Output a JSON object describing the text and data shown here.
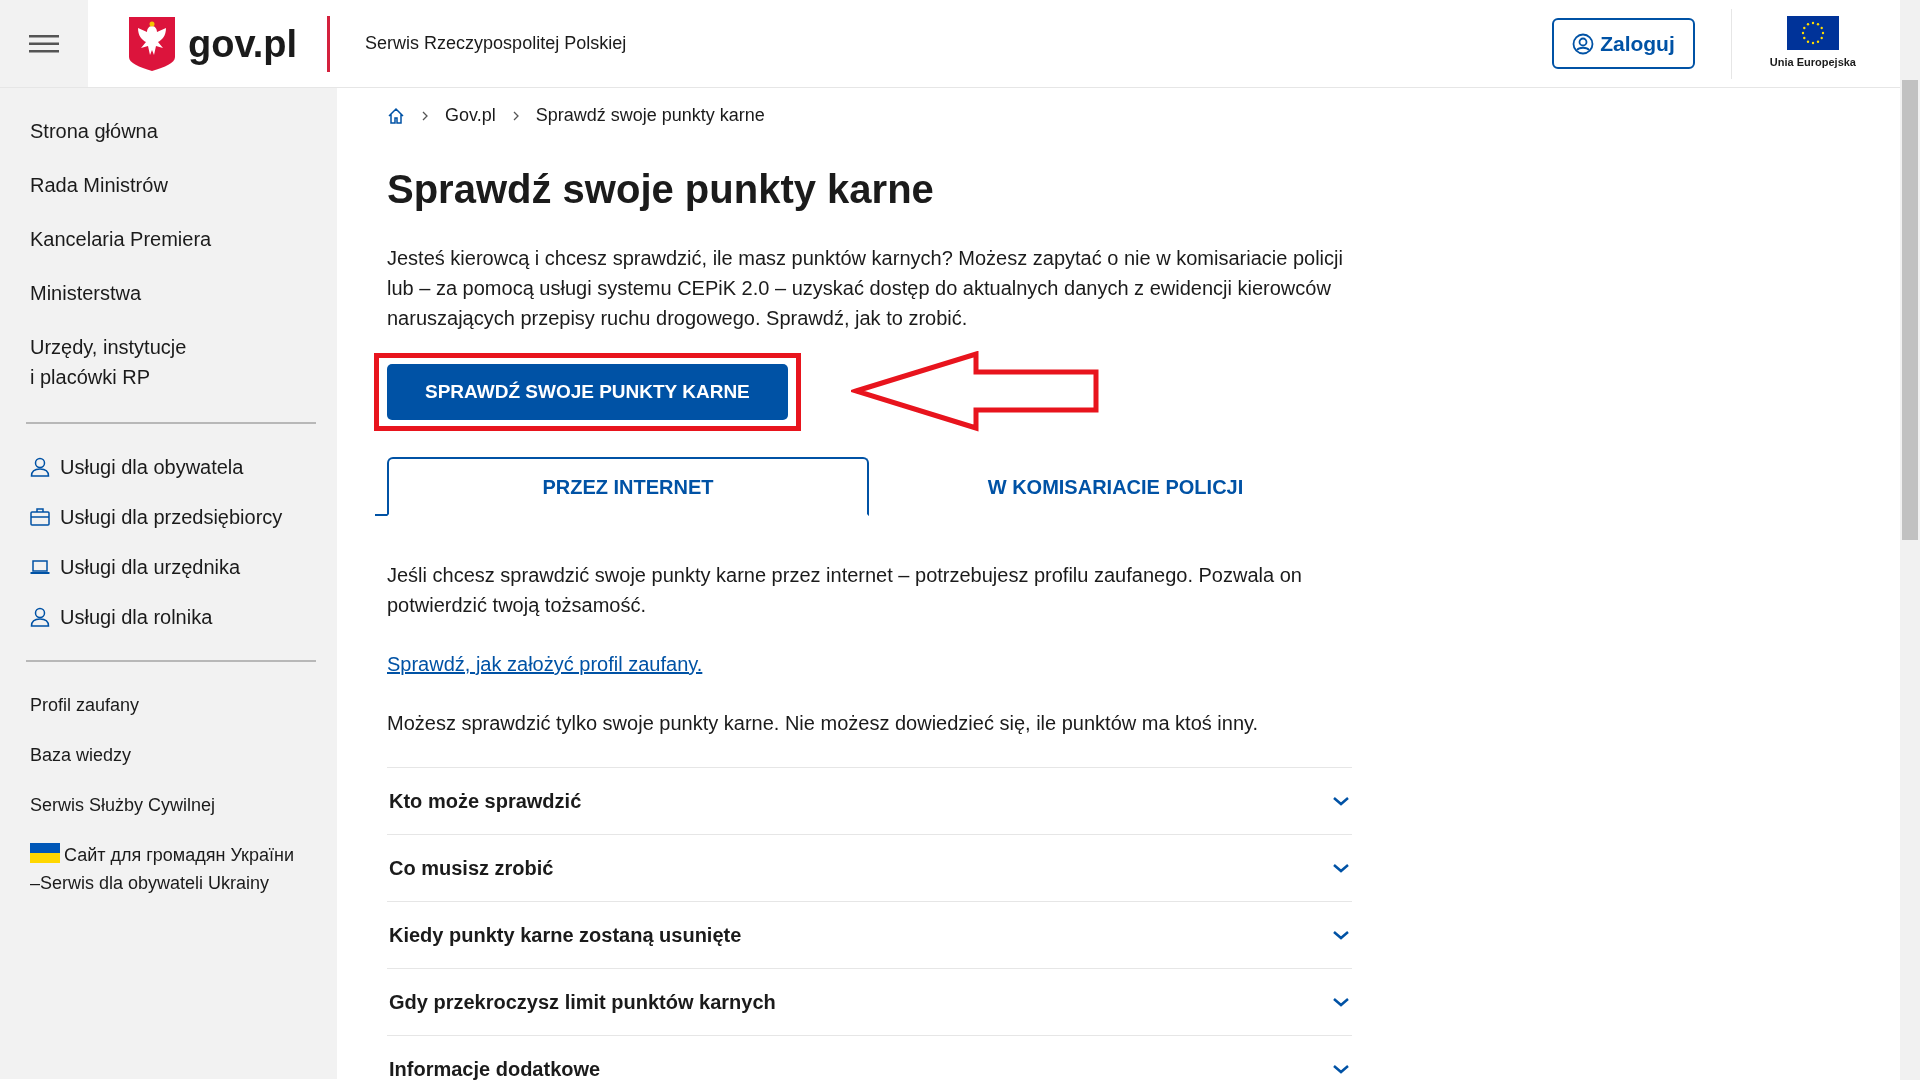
{
  "header": {
    "logo_text": "gov.pl",
    "site_name": "Serwis Rzeczypospolitej Polskiej",
    "login_button": "Zaloguj",
    "eu_label": "Unia Europejska"
  },
  "sidebar": {
    "main_items": [
      "Strona główna",
      "Rada Ministrów",
      "Kancelaria Premiera",
      "Ministerstwa",
      "Urzędy, instytucje\ni placówki RP"
    ],
    "service_items": [
      {
        "label": "Usługi dla obywatela",
        "kind": "person"
      },
      {
        "label": "Usługi dla przedsiębiorcy",
        "kind": "briefcase"
      },
      {
        "label": "Usługi dla urzędnika",
        "kind": "laptop"
      },
      {
        "label": "Usługi dla rolnika",
        "kind": "person"
      }
    ],
    "extra_items": [
      {
        "label": "Profil zaufany",
        "kind": "plain"
      },
      {
        "label": "Baza wiedzy",
        "kind": "plain"
      },
      {
        "label": "Serwis Służby Cywilnej",
        "kind": "plain"
      },
      {
        "label": "Сайт для громадян України\n–Serwis dla obywateli Ukrainy",
        "kind": "ukraine"
      }
    ]
  },
  "breadcrumb": [
    "Gov.pl",
    "Sprawdź swoje punkty karne"
  ],
  "title": "Sprawdź swoje punkty karne",
  "intro": "Jesteś kierowcą i chcesz sprawdzić, ile masz punktów karnych? Możesz zapytać o nie w komisariacie policji lub – za pomocą usługi systemu CEPiK 2.0 – uzyskać dostęp do aktualnych danych z ewidencji kierowców naruszających przepisy ruchu drogowego. Sprawdź, jak to zrobić.",
  "main_button": {
    "label": "SPRAWDŹ SWOJE PUNKTY KARNE",
    "highlighted": true,
    "pointer_arrow": true
  },
  "tabs": [
    {
      "label": "PRZEZ INTERNET",
      "selected": true
    },
    {
      "label": "W KOMISARIACIE POLICJI",
      "selected": false
    }
  ],
  "tab_content": [
    {
      "kind": "text",
      "text": "Jeśli chcesz sprawdzić swoje punkty karne przez internet – potrzebujesz profilu zaufanego. Pozwala on potwierdzić twoją tożsamość."
    },
    {
      "kind": "link",
      "text": "Sprawdź, jak założyć profil zaufany."
    },
    {
      "kind": "text",
      "text": "Możesz sprawdzić tylko swoje punkty karne. Nie możesz dowiedzieć się, ile punktów ma ktoś inny."
    }
  ],
  "accordion": [
    {
      "title": "Kto może sprawdzić",
      "expanded": false
    },
    {
      "title": "Co musisz zrobić",
      "expanded": false
    },
    {
      "title": "Kiedy punkty karne zostaną usunięte",
      "expanded": false
    },
    {
      "title": "Gdy przekroczysz limit punktów karnych",
      "expanded": false
    },
    {
      "title": "Informacje dodatkowe",
      "expanded": false
    }
  ]
}
